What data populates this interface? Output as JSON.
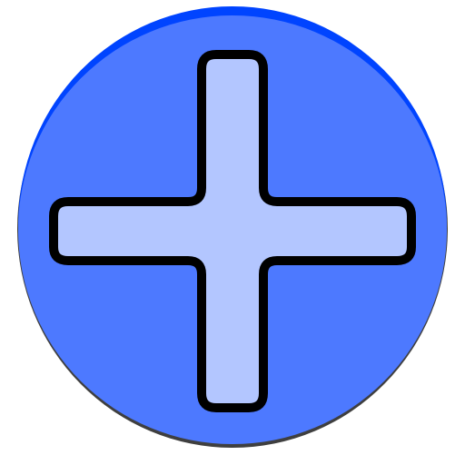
{
  "icon": {
    "name": "plus-icon",
    "colors": {
      "circle_fill": "#4d79ff",
      "circle_top_highlight": "#0044ff",
      "circle_shadow": "#3f3f3f",
      "plus_fill": "#b3c6ff",
      "plus_stroke": "#000000",
      "background": "#ffffff"
    }
  }
}
